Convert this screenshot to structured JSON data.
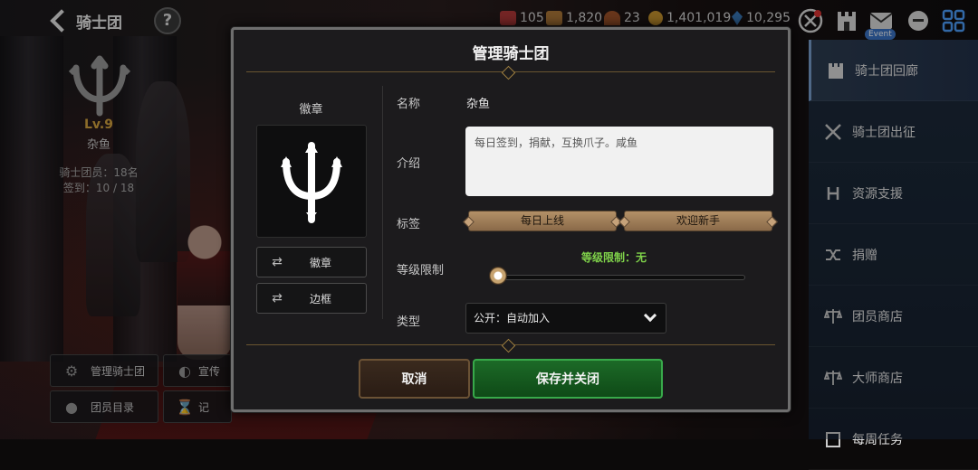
{
  "topbar": {
    "title": "骑士团",
    "help": "?",
    "resources": [
      {
        "icon": "ruby-icon",
        "value": "105",
        "color": "#b33a3a"
      },
      {
        "icon": "chest-icon",
        "value": "1,820",
        "color": "#b07a3a"
      },
      {
        "icon": "rune-icon",
        "value": "23",
        "color": "#a0542a"
      },
      {
        "icon": "gold-coin-icon",
        "value": "1,401,019",
        "color": "#c9962e"
      },
      {
        "icon": "crystal-icon",
        "value": "10,295",
        "color": "#3a78b8"
      }
    ],
    "event_label": "Event"
  },
  "guild": {
    "level": "Lv.9",
    "name": "杂鱼",
    "members": "骑士团员：18名",
    "checkin": "签到：10 / 18",
    "buttons": {
      "manage": "管理骑士团",
      "promote": "宣传",
      "roster": "团员目录",
      "record": "记"
    }
  },
  "right_menu": [
    {
      "label": "骑士团回廊",
      "icon": "castle-icon",
      "active": true
    },
    {
      "label": "骑士团出征",
      "icon": "crossed-swords-icon",
      "active": false
    },
    {
      "label": "资源支援",
      "icon": "support-icon",
      "active": false
    },
    {
      "label": "捐赠",
      "icon": "shuffle-icon",
      "active": false
    },
    {
      "label": "团员商店",
      "icon": "scale-icon",
      "active": false
    },
    {
      "label": "大师商店",
      "icon": "scale-icon",
      "active": false
    },
    {
      "label": "每周任务",
      "icon": "quest-icon",
      "active": false
    }
  ],
  "modal": {
    "title": "管理骑士团",
    "emblem_label": "徽章",
    "emblem_button": "徽章",
    "frame_button": "边框",
    "fields": {
      "name_label": "名称",
      "name_value": "杂鱼",
      "intro_label": "介绍",
      "intro_value": "每日签到，捐献，互换爪子。咸鱼",
      "tag_label": "标签",
      "tags": [
        "每日上线",
        "欢迎新手"
      ],
      "level_label": "等级限制",
      "level_text": "等级限制：无",
      "level_value": 0,
      "type_label": "类型",
      "type_value": "公开：自动加入"
    },
    "cancel": "取消",
    "save": "保存并关闭"
  },
  "colors": {
    "accent_gold": "#d8a640",
    "level_green": "#7fd24a",
    "save_green": "#1c6a27",
    "menu_bg": "#1d2b3c"
  }
}
